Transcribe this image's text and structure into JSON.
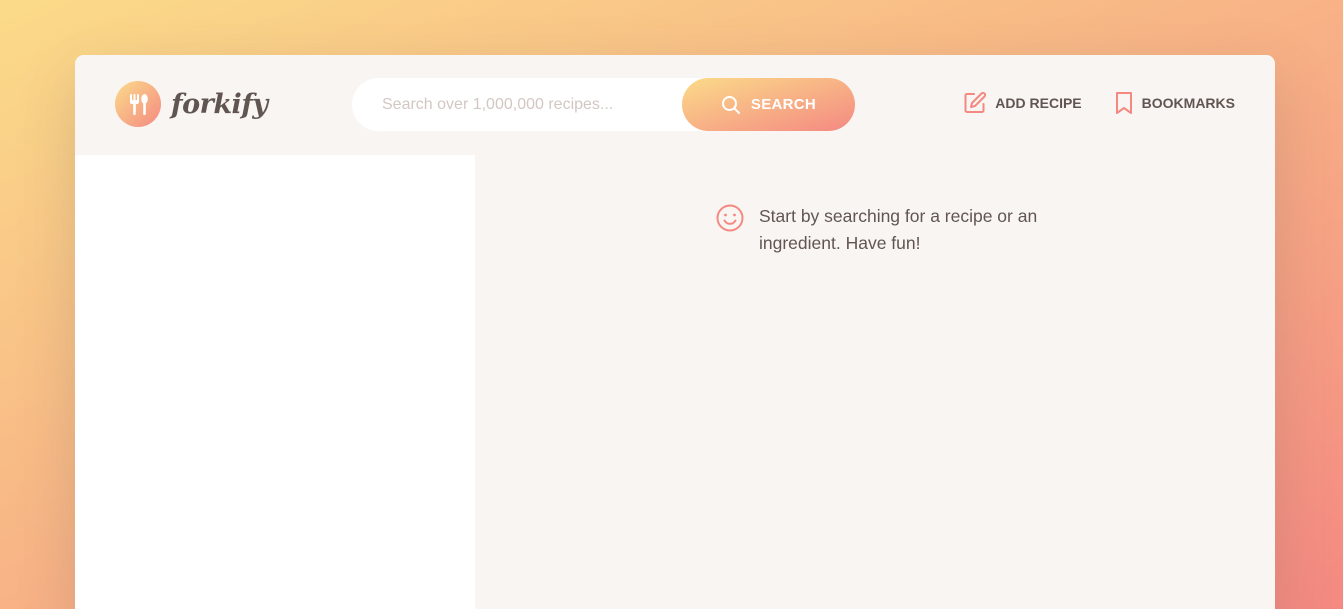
{
  "app": {
    "brand": "forkify",
    "colors": {
      "gradient_start": "#fbdb89",
      "gradient_end": "#f48982",
      "text": "#615551",
      "panel": "#f9f5f3"
    }
  },
  "header": {
    "logo_icon": "fork-spoon-icon",
    "search": {
      "placeholder": "Search over 1,000,000 recipes...",
      "value": "",
      "button_label": "SEARCH",
      "button_icon": "search-icon"
    },
    "nav": {
      "add_recipe": {
        "label": "ADD RECIPE",
        "icon": "edit-icon"
      },
      "bookmarks": {
        "label": "BOOKMARKS",
        "icon": "bookmark-icon"
      }
    }
  },
  "results": {
    "items": []
  },
  "recipe": {
    "message_icon": "smile-icon",
    "message": "Start by searching for a recipe or an ingredient. Have fun!"
  }
}
